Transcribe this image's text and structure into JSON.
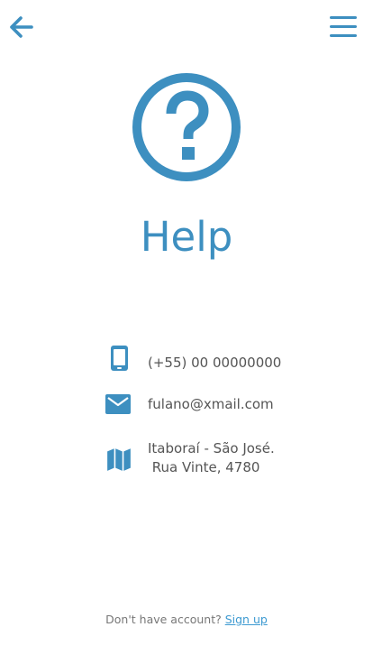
{
  "colors": {
    "accent": "#3d8fc0",
    "text": "#555555",
    "muted": "#777777",
    "link": "#3d9ad1"
  },
  "header": {
    "back_icon": "arrow-left-icon",
    "menu_icon": "hamburger-menu-icon"
  },
  "hero": {
    "icon": "question-circle-icon",
    "title": "Help"
  },
  "contacts": {
    "phone": {
      "icon": "mobile-phone-icon",
      "text": "(+55) 00 00000000"
    },
    "email": {
      "icon": "envelope-icon",
      "text": "fulano@xmail.com"
    },
    "address": {
      "icon": "map-icon",
      "line1": "Itaboraí - São José.",
      "line2": " Rua Vinte, 4780"
    }
  },
  "footer": {
    "prompt": "Don't have account? ",
    "link": "Sign up"
  }
}
